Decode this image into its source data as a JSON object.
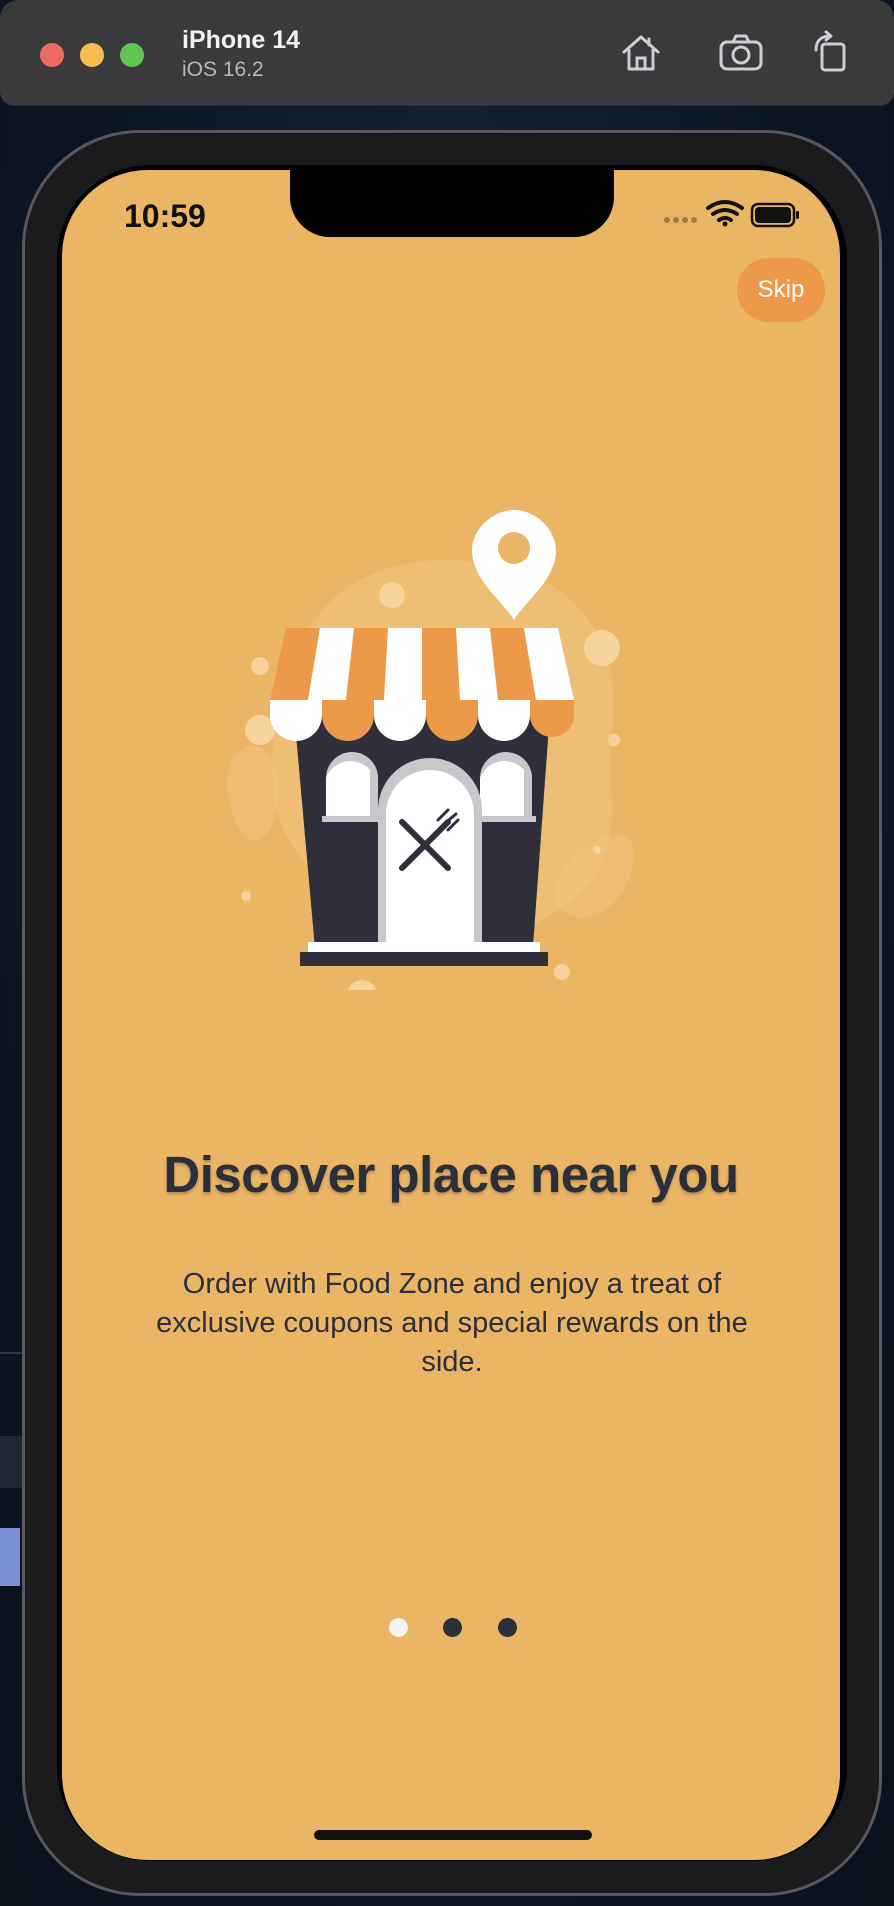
{
  "simulator": {
    "device_name": "iPhone 14",
    "os_version": "iOS 16.2",
    "toolbar": {
      "home_icon": "home-icon",
      "screenshot_icon": "camera-icon",
      "rotate_icon": "rotate-icon"
    }
  },
  "status_bar": {
    "time": "10:59",
    "icons": [
      "cellular-signal-icon",
      "wifi-icon",
      "battery-icon"
    ]
  },
  "onboarding": {
    "skip_label": "Skip",
    "illustration": "restaurant-storefront-with-location-pin",
    "title": "Discover place near you",
    "subtitle": "Order with Food Zone and enjoy a treat of exclusive coupons and special rewards on the side.",
    "page_count": 3,
    "active_page": 1
  },
  "colors": {
    "background": "#ebb566",
    "accent": "#ec9a4a",
    "text": "#2b2f3a",
    "active_dot": "#f5f3ee"
  }
}
